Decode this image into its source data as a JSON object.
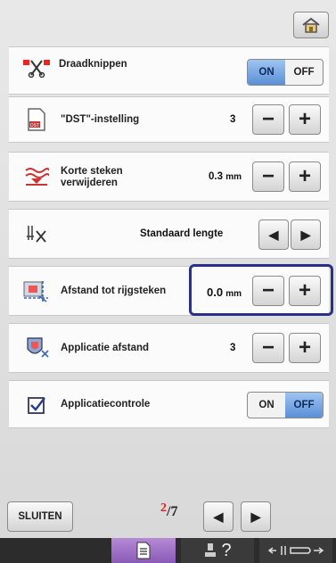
{
  "header": {
    "home_icon": "home-icon"
  },
  "rows": {
    "thread_cut": {
      "label": "Draadknippen",
      "on": "ON",
      "off": "OFF",
      "state": "on",
      "icon": "scissors-icon"
    },
    "dst": {
      "label": "\"DST\"-instelling",
      "value": "3",
      "icon": "dst-file-icon",
      "minus": "−",
      "plus": "+"
    },
    "short_stitch": {
      "label_line1": "Korte steken",
      "label_line2": "verwijderen",
      "value": "0.3",
      "unit": "mm",
      "icon": "short-stitch-icon",
      "minus": "−",
      "plus": "+"
    },
    "jump_length": {
      "value": "Standaard lengte",
      "icon": "jump-stitch-icon",
      "left": "◀",
      "right": "▶"
    },
    "basting": {
      "label": "Afstand tot rijgsteken",
      "value": "0.0",
      "unit": "mm",
      "icon": "basting-icon",
      "minus": "−",
      "plus": "+"
    },
    "applique": {
      "label": "Applicatie afstand",
      "value": "3",
      "icon": "applique-icon",
      "minus": "−",
      "plus": "+"
    },
    "applique_check": {
      "label": "Applicatiecontrole",
      "on": "ON",
      "off": "OFF",
      "state": "off",
      "icon": "checkbox-icon"
    }
  },
  "footer": {
    "close_label": "SLUITEN",
    "page_current": "2",
    "page_total": "7",
    "prev": "◀",
    "next": "▶"
  },
  "bottom_bar": {
    "tab1_icon": "settings-list-icon",
    "tab2_label": "?",
    "tab2_icon": "help-icon",
    "tab3_icon": "presser-foot-icon"
  },
  "colors": {
    "accent": "#5a8fd6",
    "highlight_border": "#2a2f8a",
    "page_number": "#dd2222"
  }
}
